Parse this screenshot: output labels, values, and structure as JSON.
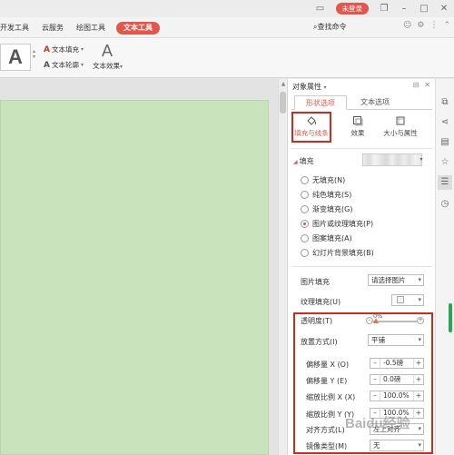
{
  "titlebar": {
    "login_label": "未登录"
  },
  "menu": {
    "tabs": [
      "开发工具",
      "云服务",
      "绘图工具",
      "文本工具"
    ],
    "search_label": "查找命令"
  },
  "ribbon": {
    "big_letter": "A",
    "text_fill": "文本填充",
    "text_outline": "文本轮廓",
    "effect_letter": "A",
    "text_effect": "文本效果"
  },
  "panel": {
    "title": "对象属性",
    "tabs": [
      "形状选项",
      "文本选项"
    ],
    "subtabs": [
      "填充与线条",
      "效果",
      "大小与属性"
    ],
    "fill_section": "填充",
    "fill_options": [
      {
        "label": "无填充(N)",
        "selected": false
      },
      {
        "label": "纯色填充(S)",
        "selected": false
      },
      {
        "label": "渐变填充(G)",
        "selected": false
      },
      {
        "label": "图片或纹理填充(P)",
        "selected": true
      },
      {
        "label": "图案填充(A)",
        "selected": false
      },
      {
        "label": "幻灯片背景填充(B)",
        "selected": false
      }
    ],
    "picture_fill_label": "图片填充",
    "picture_fill_value": "请选择图片",
    "texture_fill_label": "纹理填充(U)",
    "transparency_label": "透明度(T)",
    "transparency_value": "0%",
    "placement_label": "放置方式(I)",
    "placement_value": "平铺",
    "offset_x_label": "偏移量 X (O)",
    "offset_x_value": "-0.5磅",
    "offset_y_label": "偏移量 Y (E)",
    "offset_y_value": "0.0磅",
    "scale_x_label": "缩放比例 X (X)",
    "scale_x_value": "100.0%",
    "scale_y_label": "缩放比例 Y (Y)",
    "scale_y_value": "100.0%",
    "align_label": "对齐方式(L)",
    "align_value": "左上对齐",
    "mirror_label": "镜像类型(M)",
    "mirror_value": "无"
  },
  "watermark": "Baidu经验",
  "colors": {
    "accent": "#e2574c",
    "highlight_box": "#d5281c",
    "slide_bg": "#c9e3bc"
  }
}
